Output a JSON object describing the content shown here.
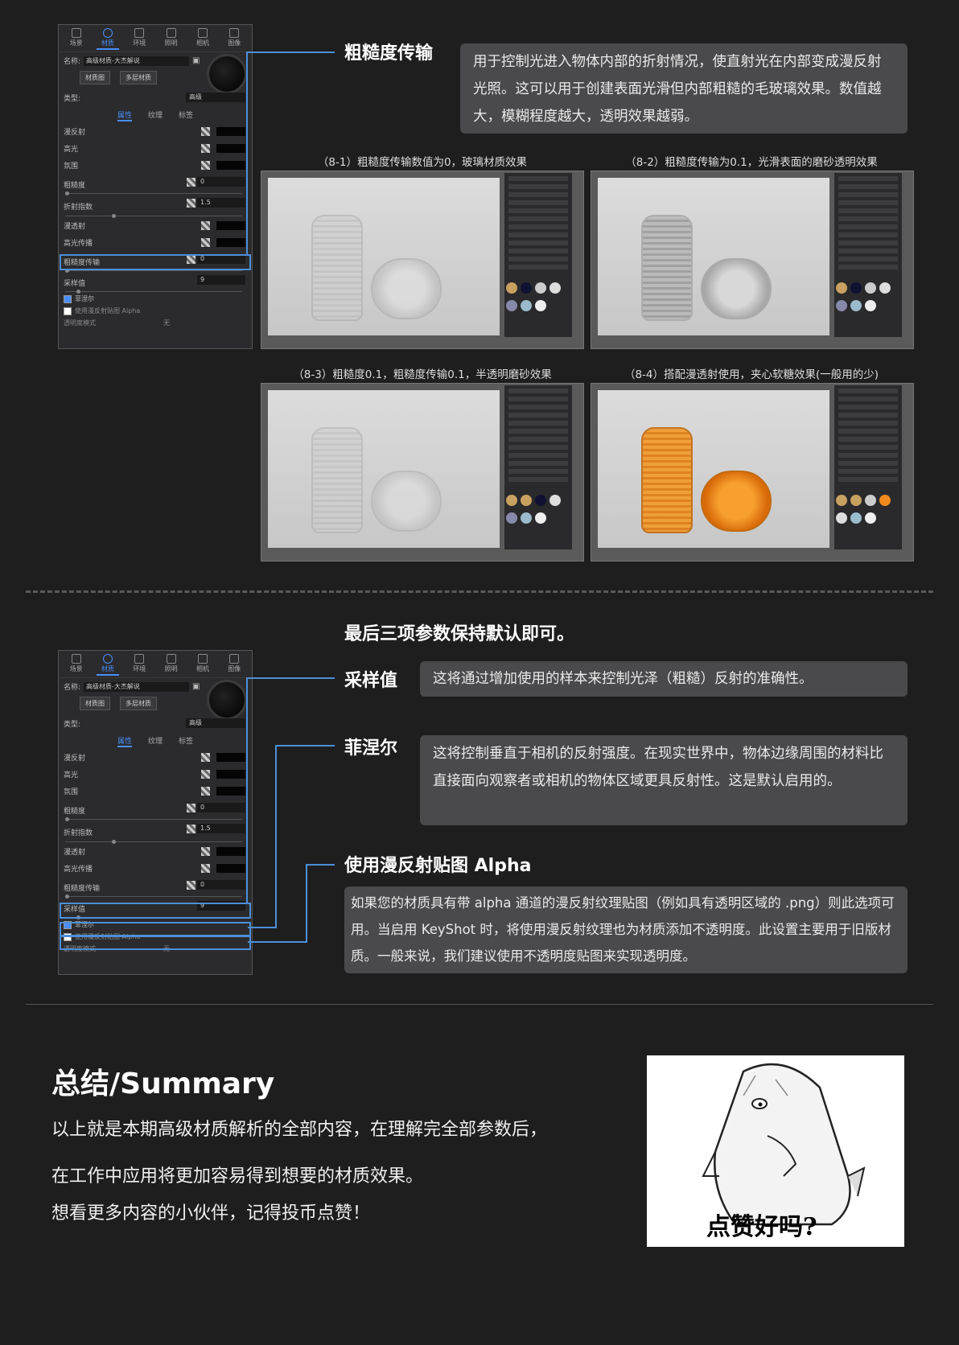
{
  "panel": {
    "tabs": [
      "场景",
      "材质",
      "环境",
      "照明",
      "相机",
      "图像"
    ],
    "name_label": "名称:",
    "name_value": "高级材质-大杰解说",
    "btn_material_map": "材质图",
    "btn_multilayer": "多层材质",
    "type_label": "类型:",
    "type_value": "高级",
    "subtabs": [
      "属性",
      "纹理",
      "标签"
    ],
    "rows": [
      "漫反射",
      "高光",
      "氛围",
      "粗糙度",
      "折射指数",
      "漫透射",
      "高光传播",
      "粗糙度传输",
      "采样值"
    ],
    "roughness_val": "0",
    "ior_val": "1.5",
    "rough_trans_val": "0",
    "samples_val": "9",
    "fresnel": "菲涅尔",
    "use_alpha": "使用漫反射贴图 Alpha",
    "transparency_mode": "透明度模式",
    "transparency_value": "无"
  },
  "section1": {
    "heading": "粗糙度传输",
    "desc": "用于控制光进入物体内部的折射情况，使直射光在内部变成漫反射光照。这可以用于创建表面光滑但内部粗糙的毛玻璃效果。数值越大，模糊程度越大，透明效果越弱。",
    "captions": [
      "（8-1）粗糙度传输数值为0，玻璃材质效果",
      "（8-2）粗糙度传输为0.1，光滑表面的磨砂透明效果",
      "（8-3）粗糙度0.1，粗糙度传输0.1，半透明磨砂效果",
      "（8-4）搭配漫透射使用，夹心软糖效果(一般用的少)"
    ]
  },
  "section2": {
    "intro": "最后三项参数保持默认即可。",
    "samples_heading": "采样值",
    "samples_desc": "这将通过增加使用的样本来控制光泽（粗糙）反射的准确性。",
    "fresnel_heading": "菲涅尔",
    "fresnel_desc": "这将控制垂直于相机的反射强度。在现实世界中，物体边缘周围的材料比直接面向观察者或相机的物体区域更具反射性。这是默认启用的。",
    "alpha_heading": "使用漫反射贴图 Alpha",
    "alpha_desc": "如果您的材质具有带 alpha 通道的漫反射纹理贴图（例如具有透明区域的 .png）则此选项可用。当启用 KeyShot 时，将使用漫反射纹理也为材质添加不透明度。此设置主要用于旧版材质。一般来说，我们建议使用不透明度贴图来实现透明度。"
  },
  "summary": {
    "heading": "总结/Summary",
    "line1": "以上就是本期高级材质解析的全部内容，在理解完全部参数后，",
    "line2": "在工作中应用将更加容易得到想要的材质效果。",
    "line3": "想看更多内容的小伙伴，记得投币点赞！",
    "meme_text": "点赞好吗?"
  },
  "colors": {
    "accent": "#4d8fd8",
    "bg": "#1e1e1f",
    "box": "#4a4a4c",
    "orange": "#f08a1e"
  }
}
